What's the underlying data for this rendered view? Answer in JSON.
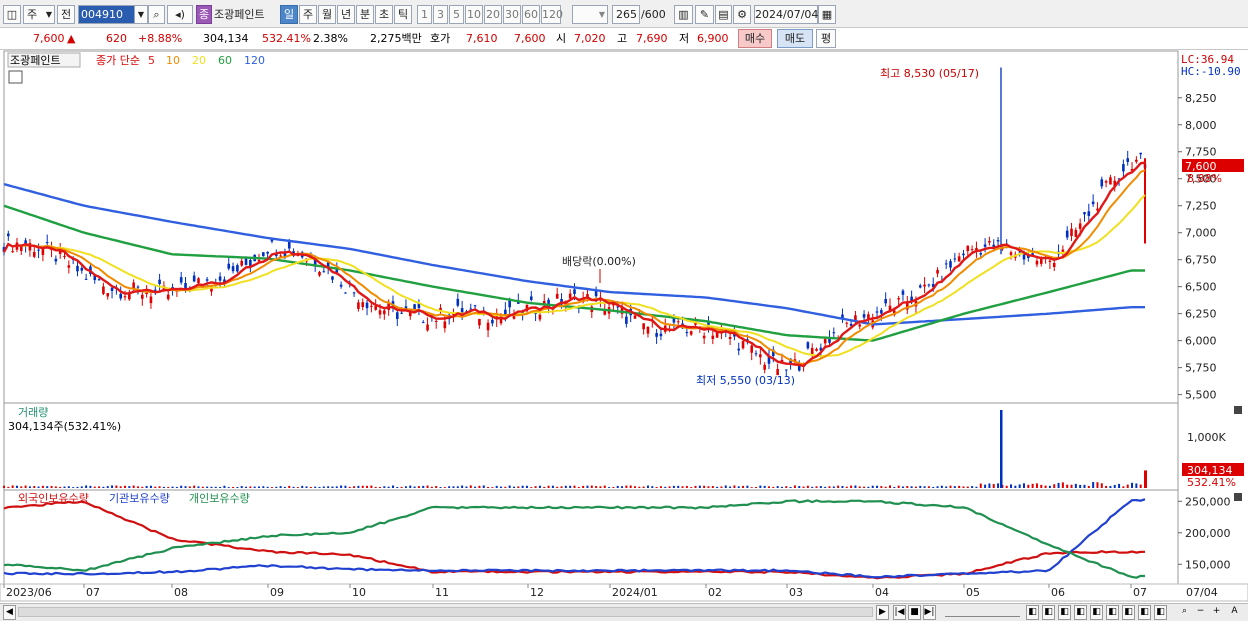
{
  "toolbar": {
    "market": "주",
    "prev": "전",
    "code": "004910",
    "stock_name_badge": "종",
    "stock_name": "조광페인트",
    "periods": [
      "일",
      "주",
      "월",
      "년",
      "분",
      "초",
      "틱"
    ],
    "active_period": "일",
    "intervals": [
      "1",
      "3",
      "5",
      "10",
      "20",
      "30",
      "60",
      "120"
    ],
    "count": "265",
    "count_total": "/600",
    "date": "2024/07/04"
  },
  "quote": {
    "price": "7,600",
    "arrow": "▲",
    "change": "620",
    "change_pct": "+8.88%",
    "volume": "304,134",
    "volume_ratio": "532.41%",
    "turnover": "2.38%",
    "amount": "2,275백만",
    "bid_label": "호가",
    "bid1": "7,610",
    "bid2": "7,600",
    "open_label": "시",
    "open": "7,020",
    "high_label": "고",
    "high": "7,690",
    "low_label": "저",
    "low": "6,900",
    "buy_button": "매수",
    "sell_button": "매도",
    "eval_button": "평"
  },
  "price_panel": {
    "name_tag": "조광페인트",
    "legend_prefix": "종가 단순",
    "ma_labels": [
      "5",
      "10",
      "20",
      "60",
      "120"
    ],
    "lc": "LC:36.94",
    "hc": "HC:-10.90",
    "high_note": "최고 8,530 (05/17)",
    "low_note": "최저 5,550 (03/13)",
    "dividend_note": "배당락(0.00%)",
    "last_price_tag": "7,600",
    "last_pct_tag": "8.88%",
    "y_ticks": [
      "8,250",
      "8,000",
      "7,750",
      "7,500",
      "7,250",
      "7,000",
      "6,750",
      "6,500",
      "6,250",
      "6,000",
      "5,750",
      "5,500"
    ]
  },
  "volume_panel": {
    "title": "거래량",
    "value": "304,134주(532.41%)",
    "y_tick": "1,000K",
    "last_tag": "304,134",
    "last_pct": "532.41%"
  },
  "holdings_panel": {
    "legend": [
      "외국인보유수량",
      "기관보유수량",
      "개인보유수량"
    ],
    "y_ticks": [
      "250,000",
      "200,000",
      "150,000"
    ]
  },
  "x_axis": {
    "labels": [
      "2023/06",
      "07",
      "08",
      "09",
      "10",
      "11",
      "12",
      "2024/01",
      "02",
      "03",
      "04",
      "05",
      "06",
      "07"
    ],
    "right_label": "07/04"
  },
  "colors": {
    "ma5": "#e01818",
    "ma10": "#f08c00",
    "ma20": "#f0e020",
    "ma60": "#20a040",
    "ma120": "#3060e0",
    "foreign": "#d01010",
    "institution": "#2040d0",
    "individual": "#209050",
    "up": "#e00000",
    "down": "#0030c0"
  },
  "chart_data": {
    "type": "line",
    "title": "조광페인트",
    "x": [
      "2023/06",
      "2023/07",
      "2023/08",
      "2023/09",
      "2023/10",
      "2023/11",
      "2023/12",
      "2024/01",
      "2024/02",
      "2024/03",
      "2024/04",
      "2024/05",
      "2024/06",
      "2024/07"
    ],
    "series": [
      {
        "name": "종가",
        "values": [
          6900,
          6650,
          6350,
          6900,
          6500,
          6150,
          6350,
          6300,
          6050,
          5800,
          6200,
          6800,
          6800,
          7600
        ]
      },
      {
        "name": "60",
        "values": [
          7250,
          7000,
          6800,
          6760,
          6650,
          6500,
          6350,
          6280,
          6180,
          6050,
          6000,
          6250,
          6450,
          6650
        ]
      },
      {
        "name": "120",
        "values": [
          7450,
          7250,
          7100,
          6950,
          6850,
          6700,
          6550,
          6450,
          6400,
          6300,
          6150,
          6200,
          6250,
          6310
        ]
      }
    ],
    "annotations": [
      "최고 8,530 (05/17)",
      "최저 5,550 (03/13)",
      "배당락(0.00%)"
    ],
    "ylim": [
      5450,
      8600
    ],
    "volume": {
      "last": 304134,
      "peak": 1350000
    },
    "holdings": {
      "series": [
        {
          "name": "외국인보유수량",
          "values": [
            240000,
            250000,
            190000,
            170000,
            165000,
            138000,
            138000,
            138000,
            138000,
            138000,
            128000,
            135000,
            168000,
            170000
          ]
        },
        {
          "name": "기관보유수량",
          "values": [
            135000,
            135000,
            138000,
            148000,
            142000,
            140000,
            140000,
            140000,
            140000,
            140000,
            130000,
            135000,
            140000,
            252000
          ]
        },
        {
          "name": "개인보유수량",
          "values": [
            150000,
            140000,
            175000,
            195000,
            200000,
            240000,
            240000,
            240000,
            240000,
            250000,
            250000,
            240000,
            180000,
            130000
          ]
        }
      ],
      "ylim": [
        125000,
        260000
      ]
    }
  }
}
